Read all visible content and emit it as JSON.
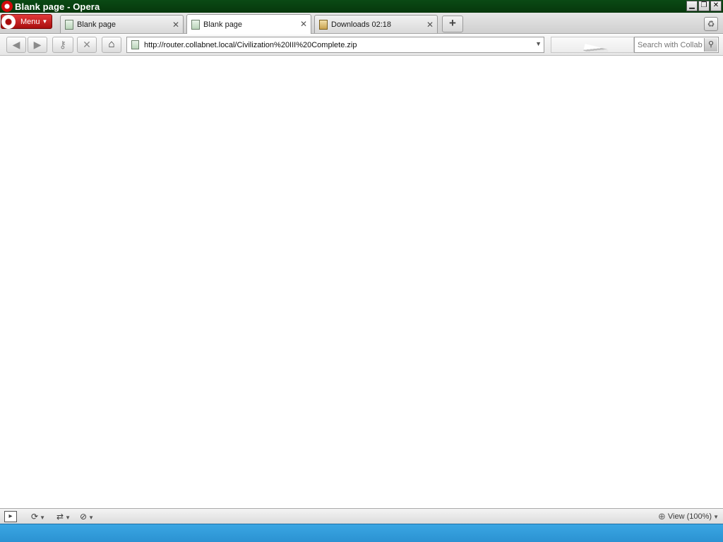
{
  "window": {
    "title": "Blank page - Opera",
    "minimize": "▁",
    "restore": "❐",
    "close": "✕"
  },
  "menu": {
    "label": "Menu",
    "caret": "▼"
  },
  "tabs": [
    {
      "label": "Blank page",
      "icon": "page-icon",
      "close": "✕",
      "active": false
    },
    {
      "label": "Blank page",
      "icon": "page-icon",
      "close": "✕",
      "active": true
    },
    {
      "label": "Downloads 02:18",
      "icon": "download-icon",
      "close": "✕",
      "active": false
    }
  ],
  "new_tab": "+",
  "trash": "♻",
  "nav": {
    "back": "◀",
    "forward": "▶",
    "key": "⚷",
    "stop": "✕",
    "home": "⌂"
  },
  "address": {
    "url": "http://router.collabnet.local/Civilization%20III%20Complete.zip",
    "dropdown": "▼"
  },
  "search": {
    "placeholder": "Search with Collab'",
    "button": "⚲"
  },
  "status": {
    "panel_icon": "▸",
    "reload_icon": "⟳",
    "network_icon": "⇄",
    "security_icon": "⊘",
    "caret": "▼",
    "zoom_label": "View (100%)",
    "zoom_icon": "⊕"
  },
  "colors": {
    "titlebar": "#06380c",
    "menu": "#c01a1a",
    "taskbar": "#2b92d2"
  }
}
